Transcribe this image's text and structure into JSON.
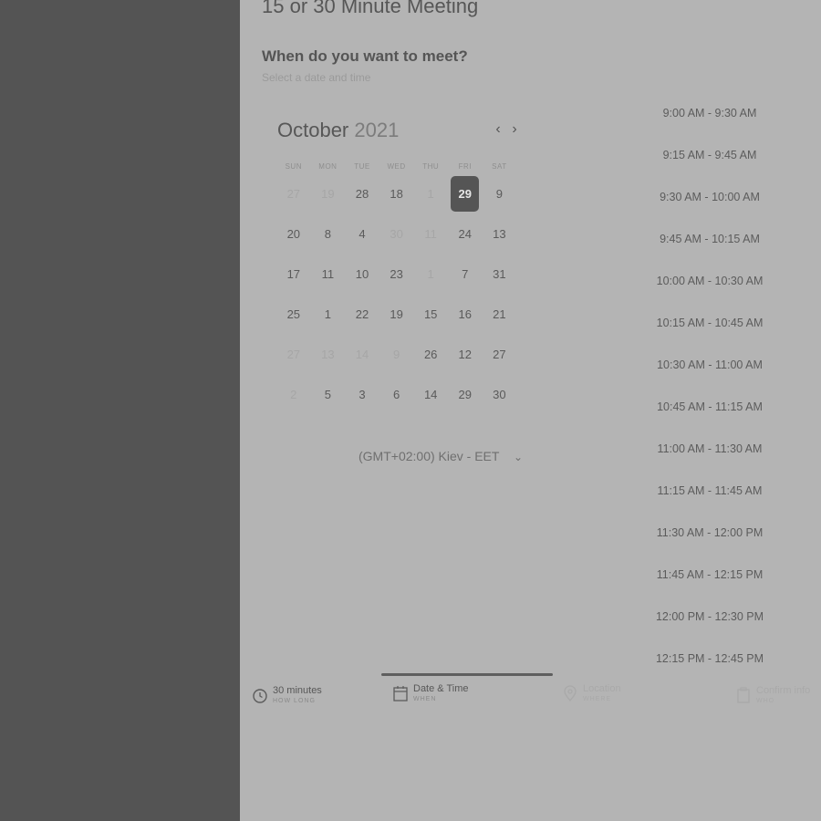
{
  "page": {
    "title": "15 or 30 Minute Meeting",
    "question": "When do you want to meet?",
    "subtitle": "Select a date and time"
  },
  "calendar": {
    "month": "October",
    "year": "2021",
    "weekdays": [
      "SUN",
      "MON",
      "TUE",
      "WED",
      "THU",
      "FRI",
      "SAT"
    ],
    "weeks": [
      [
        {
          "d": "27",
          "m": true
        },
        {
          "d": "19",
          "m": true
        },
        {
          "d": "28"
        },
        {
          "d": "18"
        },
        {
          "d": "1",
          "m": true
        },
        {
          "d": "29",
          "s": true
        },
        {
          "d": "9"
        }
      ],
      [
        {
          "d": "20"
        },
        {
          "d": "8"
        },
        {
          "d": "4"
        },
        {
          "d": "30",
          "m": true
        },
        {
          "d": "11",
          "m": true
        },
        {
          "d": "24"
        },
        {
          "d": "13"
        }
      ],
      [
        {
          "d": "17"
        },
        {
          "d": "11"
        },
        {
          "d": "10"
        },
        {
          "d": "23"
        },
        {
          "d": "1",
          "m": true
        },
        {
          "d": "7"
        },
        {
          "d": "31"
        }
      ],
      [
        {
          "d": "25"
        },
        {
          "d": "1"
        },
        {
          "d": "22"
        },
        {
          "d": "19"
        },
        {
          "d": "15"
        },
        {
          "d": "16"
        },
        {
          "d": "21"
        }
      ],
      [
        {
          "d": "27",
          "m": true
        },
        {
          "d": "13",
          "m": true
        },
        {
          "d": "14",
          "m": true
        },
        {
          "d": "9",
          "m": true
        },
        {
          "d": "26"
        },
        {
          "d": "12"
        },
        {
          "d": "27"
        }
      ],
      [
        {
          "d": "2",
          "m": true
        },
        {
          "d": "5"
        },
        {
          "d": "3"
        },
        {
          "d": "6"
        },
        {
          "d": "14"
        },
        {
          "d": "29"
        },
        {
          "d": "30"
        }
      ]
    ]
  },
  "timezone": "(GMT+02:00) Kiev - EET",
  "slots": [
    "9:00 AM - 9:30 AM",
    "9:15 AM - 9:45 AM",
    "9:30 AM - 10:00 AM",
    "9:45 AM - 10:15 AM",
    "10:00 AM - 10:30 AM",
    "10:15 AM - 10:45 AM",
    "10:30 AM - 11:00 AM",
    "10:45 AM - 11:15 AM",
    "11:00 AM - 11:30 AM",
    "11:15 AM - 11:45 AM",
    "11:30 AM - 12:00 PM",
    "11:45 AM - 12:15 PM",
    "12:00 PM - 12:30 PM",
    "12:15 PM - 12:45 PM"
  ],
  "steps": [
    {
      "label": "30 minutes",
      "sub": "HOW LONG",
      "icon": "clock-icon"
    },
    {
      "label": "Date & Time",
      "sub": "WHEN",
      "icon": "calendar-icon"
    },
    {
      "label": "Location",
      "sub": "WHERE",
      "icon": "location-pin-icon"
    },
    {
      "label": "Confirm info",
      "sub": "WHO",
      "icon": "clipboard-icon"
    }
  ]
}
